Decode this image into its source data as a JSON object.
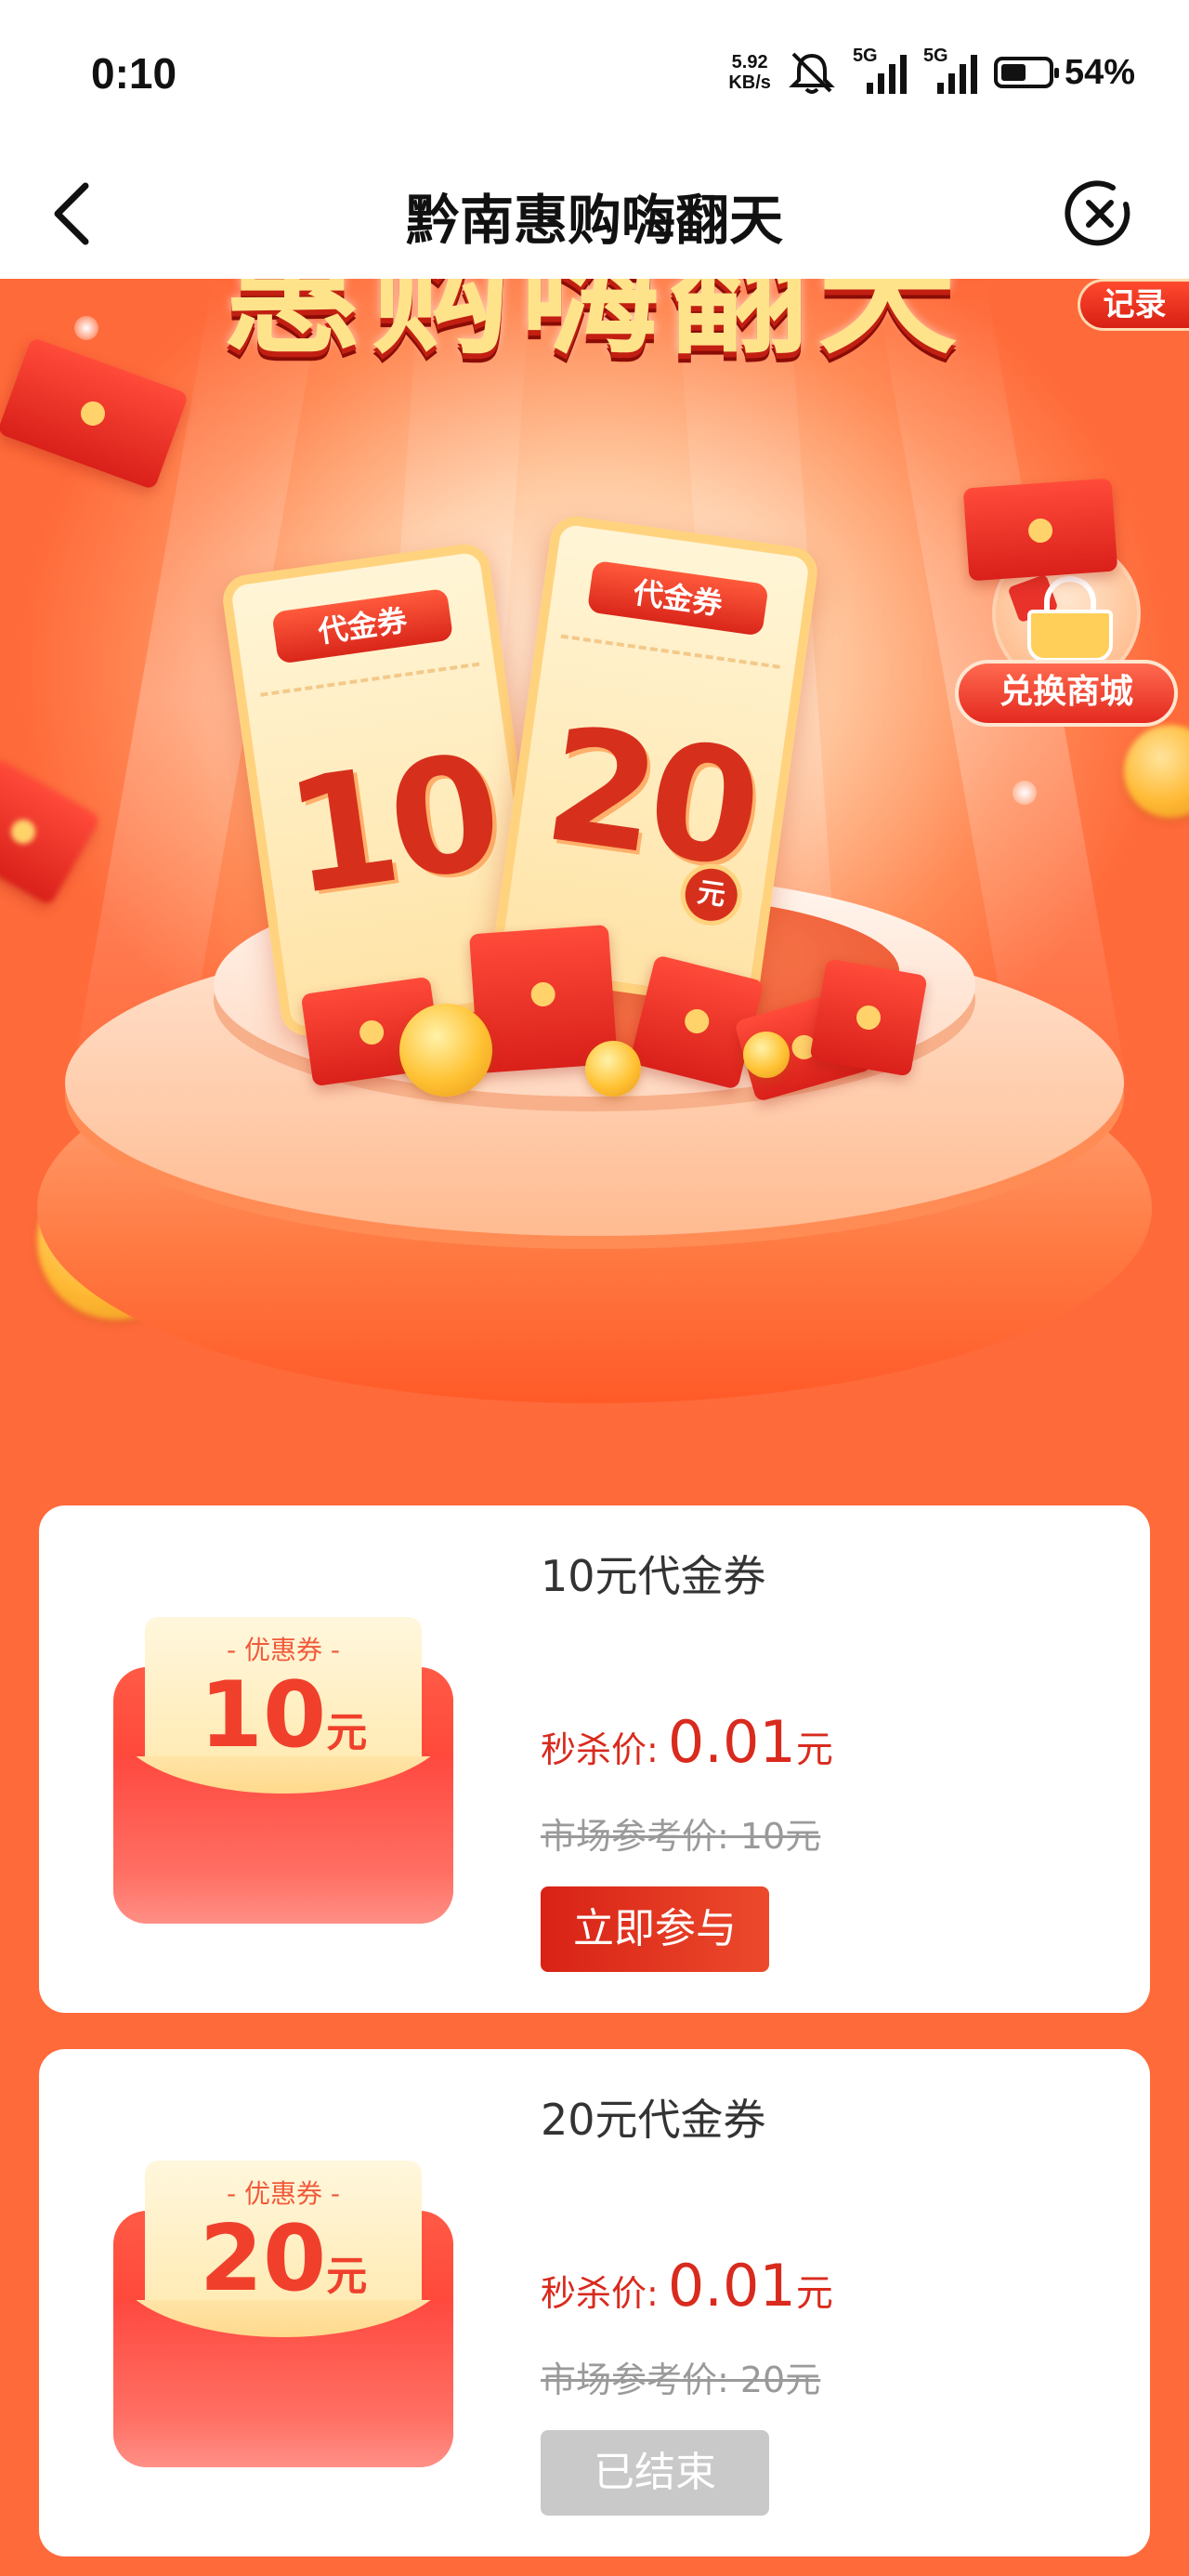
{
  "status_bar": {
    "time": "0:10",
    "net_speed_value": "5.92",
    "net_speed_unit": "KB/s",
    "sim1_label": "5G",
    "sim2_label": "5G",
    "battery_level": 0.54,
    "battery_text": "54%",
    "icons": [
      "mute-icon",
      "signal-icon",
      "battery-icon"
    ]
  },
  "nav": {
    "title": "黔南惠购嗨翻天",
    "back_icon": "chevron-left-icon",
    "close_icon": "close-circle-icon"
  },
  "hero": {
    "banner_text": "惠购嗨翻天",
    "record_label": "记录",
    "shop_label": "兑换商城",
    "ticket_left_tag": "代金券",
    "ticket_left_amount": "10",
    "ticket_right_tag": "代金券",
    "ticket_right_amount": "20",
    "ticket_right_unit": "元"
  },
  "products": [
    {
      "title": "10元代金券",
      "coupon_label": "- 优惠券 -",
      "coupon_value": "10",
      "coupon_unit": "元",
      "price_label": "秒杀价:",
      "price_value": "0.01",
      "price_unit": "元",
      "market_price": "市场参考价: 10元",
      "button_label": "立即参与",
      "button_state": "active"
    },
    {
      "title": "20元代金券",
      "coupon_label": "- 优惠券 -",
      "coupon_value": "20",
      "coupon_unit": "元",
      "price_label": "秒杀价:",
      "price_value": "0.01",
      "price_unit": "元",
      "market_price": "市场参考价: 20元",
      "button_label": "已结束",
      "button_state": "ended"
    }
  ],
  "colors": {
    "page_bg": "#ff6a3a",
    "price_red": "#d92a1e",
    "button_red": "#d82216",
    "button_disabled": "#c9c9c9"
  }
}
